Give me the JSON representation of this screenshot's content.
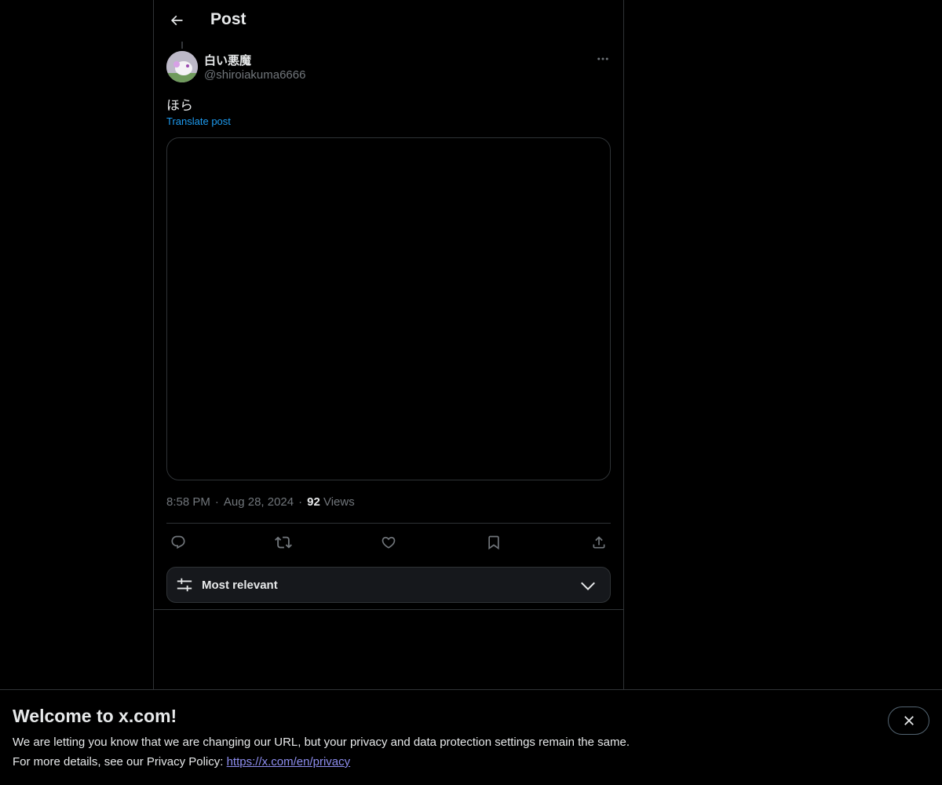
{
  "header": {
    "title": "Post"
  },
  "post": {
    "author": {
      "display_name": "白い悪魔",
      "handle": "@shiroiakuma6666"
    },
    "text": "ほら",
    "translate_label": "Translate post",
    "time": "8:58 PM",
    "date": "Aug 28, 2024",
    "separator": "·",
    "views_count": "92",
    "views_label": "Views"
  },
  "actions": [
    {
      "icon": "reply-icon"
    },
    {
      "icon": "repost-icon"
    },
    {
      "icon": "like-icon"
    },
    {
      "icon": "bookmark-icon"
    },
    {
      "icon": "share-icon"
    }
  ],
  "replies_sort": {
    "label": "Most relevant"
  },
  "banner": {
    "title": "Welcome to x.com!",
    "line1": "We are letting you know that we are changing our URL, but your privacy and data protection settings remain the same.",
    "line2_prefix": "For more details, see our Privacy Policy: ",
    "link": "https://x.com/en/privacy"
  },
  "colors": {
    "background": "#000000",
    "accent": "#1d9bf0",
    "text": "#e7e9ea",
    "muted": "#71767b",
    "border": "#2f3336"
  }
}
